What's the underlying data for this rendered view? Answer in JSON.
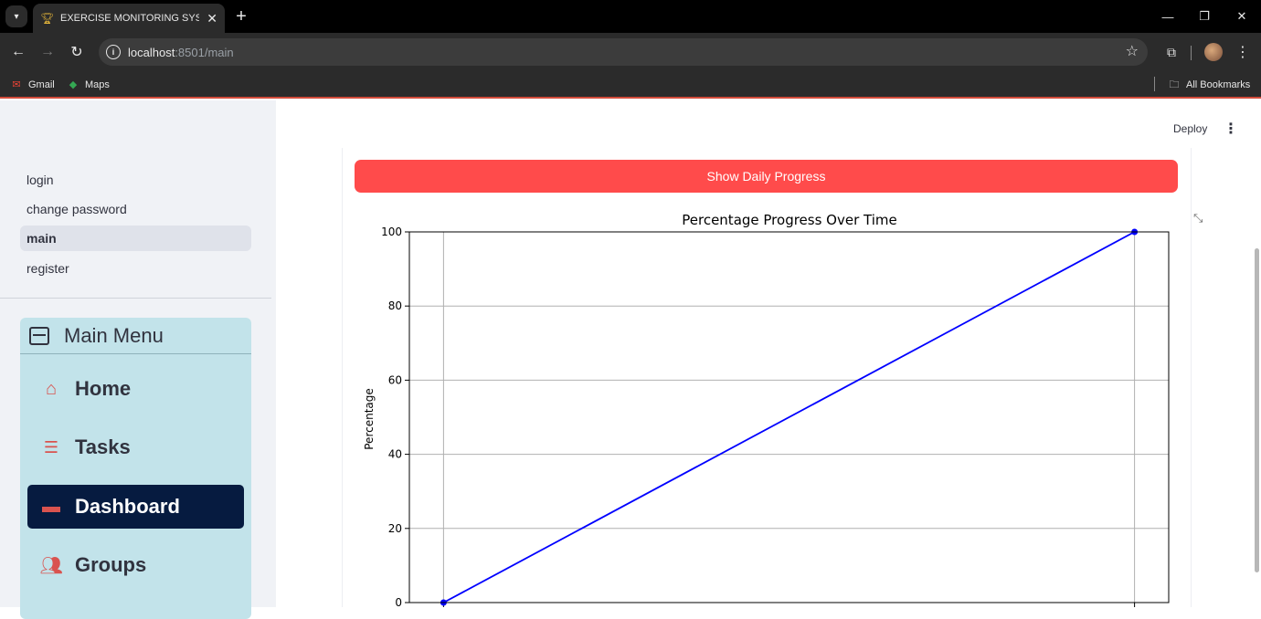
{
  "browser": {
    "tab_title": "EXERCISE MONITORING SYSTEM",
    "url_host": "localhost",
    "url_rest": ":8501/main",
    "bookmarks": [
      {
        "label": "Gmail",
        "icon": "gmail-icon"
      },
      {
        "label": "Maps",
        "icon": "maps-icon"
      }
    ],
    "all_bookmarks": "All Bookmarks"
  },
  "sidebar": {
    "pages": [
      {
        "label": "login",
        "active": false
      },
      {
        "label": "change password",
        "active": false
      },
      {
        "label": "main",
        "active": true
      },
      {
        "label": "register",
        "active": false
      }
    ],
    "menu": {
      "title": "Main Menu",
      "items": [
        {
          "label": "Home",
          "icon": "home-icon",
          "active": false
        },
        {
          "label": "Tasks",
          "icon": "list-icon",
          "active": false
        },
        {
          "label": "Dashboard",
          "icon": "monitor-icon",
          "active": true
        },
        {
          "label": "Groups",
          "icon": "people-icon",
          "active": false
        }
      ]
    }
  },
  "header": {
    "deploy_label": "Deploy"
  },
  "main": {
    "button_label": "Show Daily Progress"
  },
  "chart_data": {
    "type": "line",
    "title": "Percentage Progress Over Time",
    "xlabel": "",
    "ylabel": "Percentage",
    "ylim": [
      0,
      100
    ],
    "yticks": [
      0,
      20,
      40,
      60,
      80,
      100
    ],
    "grid": true,
    "series": [
      {
        "color": "#0000ff",
        "marker": "circle",
        "values": [
          0,
          100
        ]
      }
    ]
  },
  "colors": {
    "primary_button": "#ff4b4b",
    "menu_background": "#c2e3ea",
    "menu_active": "#061b40",
    "menu_icon": "#d9534f",
    "line": "#0000ff"
  }
}
